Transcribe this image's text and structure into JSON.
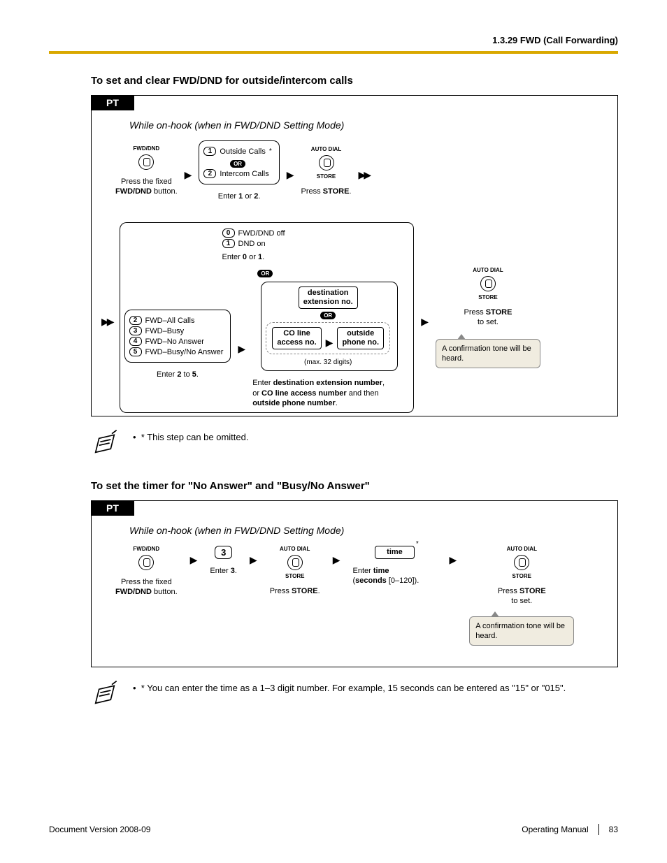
{
  "header": "1.3.29 FWD (Call Forwarding)",
  "section1_title": "To set and clear FWD/DND for outside/intercom calls",
  "section2_title": "To set the timer for \"No Answer\" and \"Busy/No Answer\"",
  "pt_label": "PT",
  "subtitle": "While on-hook (when in FWD/DND Setting Mode)",
  "fwd_dnd_label": "FWD/DND",
  "press_fixed_line1": "Press the fixed",
  "press_fixed_line2": "FWD/DND",
  "press_fixed_line3": " button.",
  "or_label": "OR",
  "step1": {
    "opt1_key": "1",
    "opt1_label": "Outside Calls",
    "opt2_key": "2",
    "opt2_label": "Intercom Calls",
    "caption_enter": "Enter ",
    "caption_b1": "1",
    "caption_or": " or ",
    "caption_b2": "2",
    "caption_dot": "."
  },
  "auto_dial": "AUTO DIAL",
  "store_small": "STORE",
  "press_store": "Press ",
  "store_b": "STORE",
  "dot": ".",
  "off_opts": {
    "k0": "0",
    "l0": "FWD/DND off",
    "k1": "1",
    "l1": "DND on",
    "cap_pre": "Enter ",
    "cap_b0": "0",
    "cap_or": " or ",
    "cap_b1": "1",
    "cap_dot": "."
  },
  "fwd_opts": {
    "k2": "2",
    "l2": "FWD–All Calls",
    "k3": "3",
    "l3": "FWD–Busy",
    "k4": "4",
    "l4": "FWD–No Answer",
    "k5": "5",
    "l5": "FWD–Busy/No Answer",
    "cap_pre": "Enter ",
    "cap_b2": "2",
    "cap_to": " to ",
    "cap_b5": "5",
    "cap_dot": "."
  },
  "dest_ext_l1": "destination",
  "dest_ext_l2": "extension no.",
  "co_l1": "CO line",
  "co_l2": "access no.",
  "out_l1": "outside",
  "out_l2": "phone no.",
  "max_digits": "(max. 32 digits)",
  "dest_cap_pre": "Enter ",
  "dest_cap_b1": "destination extension number",
  "dest_cap_mid": ",\nor ",
  "dest_cap_b2": "CO line access number",
  "dest_cap_mid2": " and then\n",
  "dest_cap_b3": "outside phone number",
  "press_store_set_l1": "Press ",
  "press_store_set_b": "STORE",
  "press_store_set_l2": "to set.",
  "bubble_text": "A confirmation tone will be heard.",
  "note1_bullet": "•",
  "note1_text": "* This step can be omitted.",
  "timer": {
    "key3": "3",
    "enter3_pre": "Enter ",
    "enter3_b": "3",
    "enter3_dot": ".",
    "time_label": "time",
    "enter_time_pre": "Enter ",
    "enter_time_b": "time",
    "enter_time_mid": "\n(",
    "enter_time_b2": "seconds",
    "enter_time_suf": " [0–120])."
  },
  "note2_text": "* You can enter the time as a 1–3 digit number. For example, 15 seconds can be entered as \"15\" or \"015\".",
  "footer_left": "Document Version  2008-09",
  "footer_manual": "Operating Manual",
  "footer_page": "83"
}
